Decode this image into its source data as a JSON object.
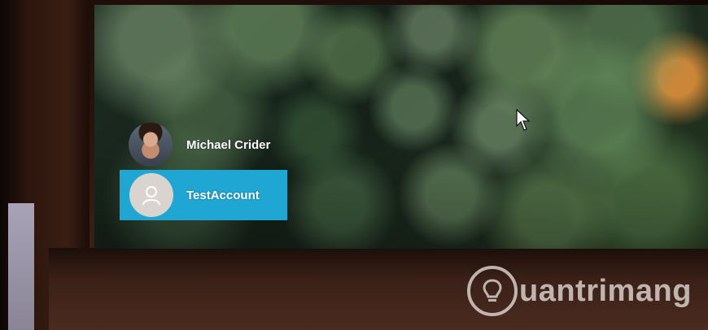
{
  "lock_screen": {
    "users": [
      {
        "name": "Michael Crider",
        "selected": false,
        "avatar": "user-photo"
      },
      {
        "name": "TestAccount",
        "selected": true,
        "avatar": "default-user-icon"
      }
    ],
    "selected_color": "#20a6d3"
  },
  "watermark": {
    "text": "uantrimang",
    "logo": "lightbulb-icon"
  }
}
